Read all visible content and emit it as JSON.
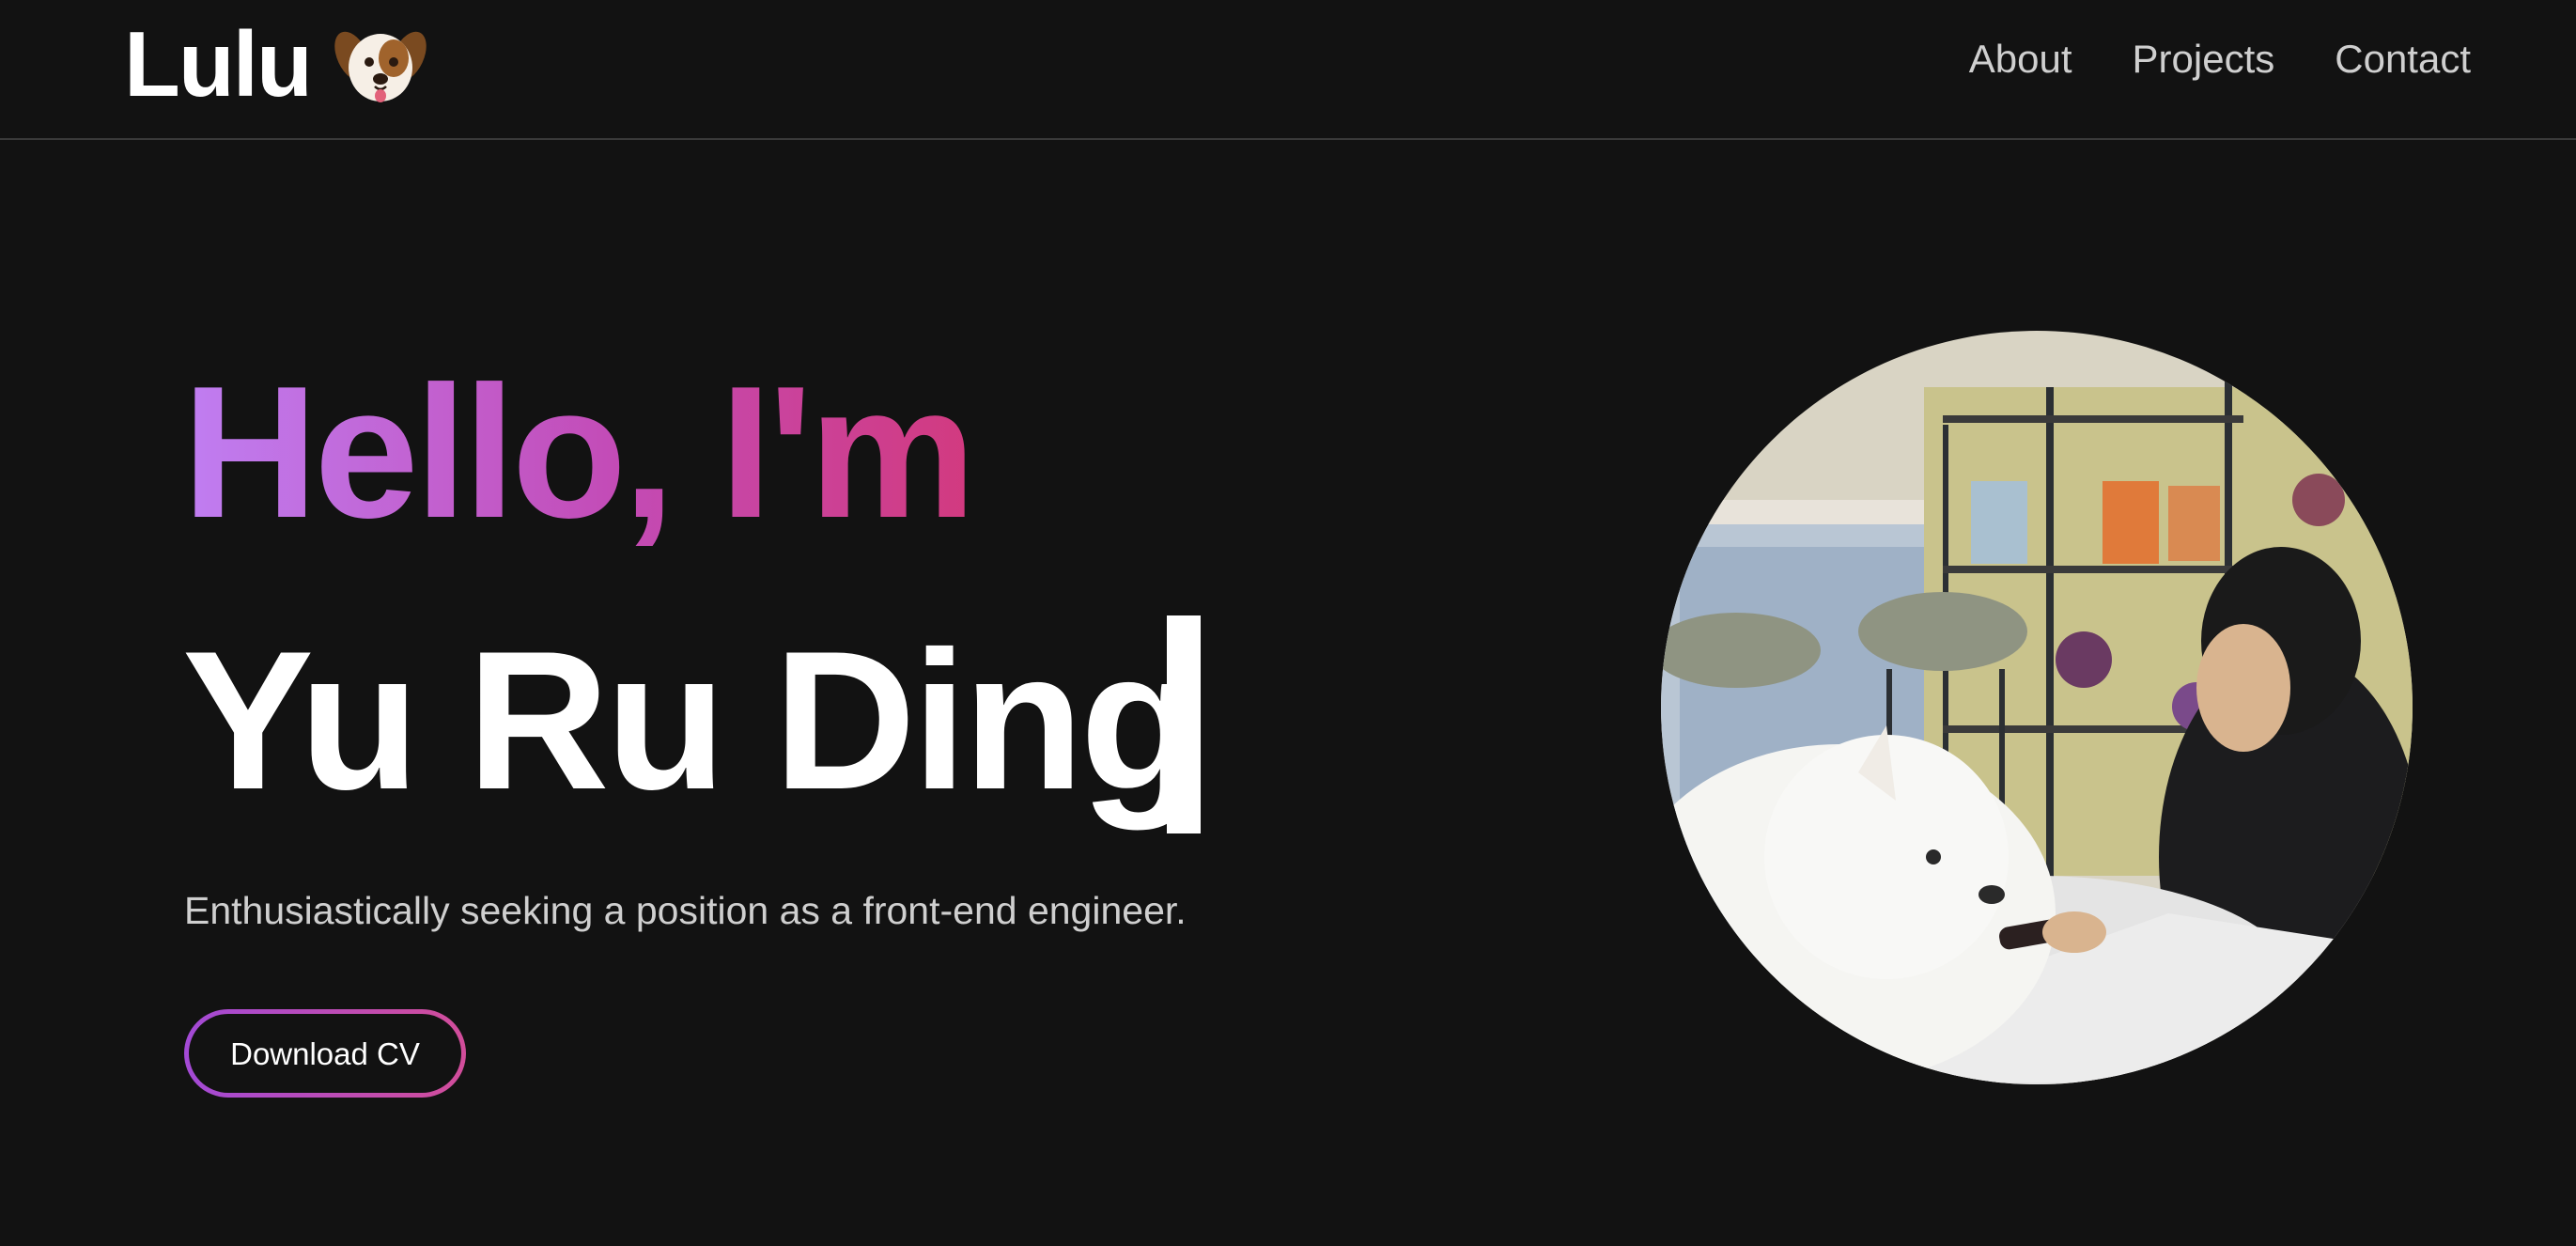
{
  "navbar": {
    "brand": "Lulu",
    "brand_icon": "dog-face-icon",
    "links": [
      {
        "label": "About"
      },
      {
        "label": "Projects"
      },
      {
        "label": "Contact"
      }
    ]
  },
  "hero": {
    "greeting": "Hello, I'm",
    "name": "Yu Ru Ding",
    "subtitle": "Enthusiastically seeking a position as a front-end engineer.",
    "cta_label": "Download CV"
  },
  "colors": {
    "background": "#121212",
    "gradient_start": "#c07ef2",
    "gradient_end": "#d23a7f",
    "text_muted": "#cfcfcf"
  },
  "photo": {
    "icon": "profile-photo"
  }
}
